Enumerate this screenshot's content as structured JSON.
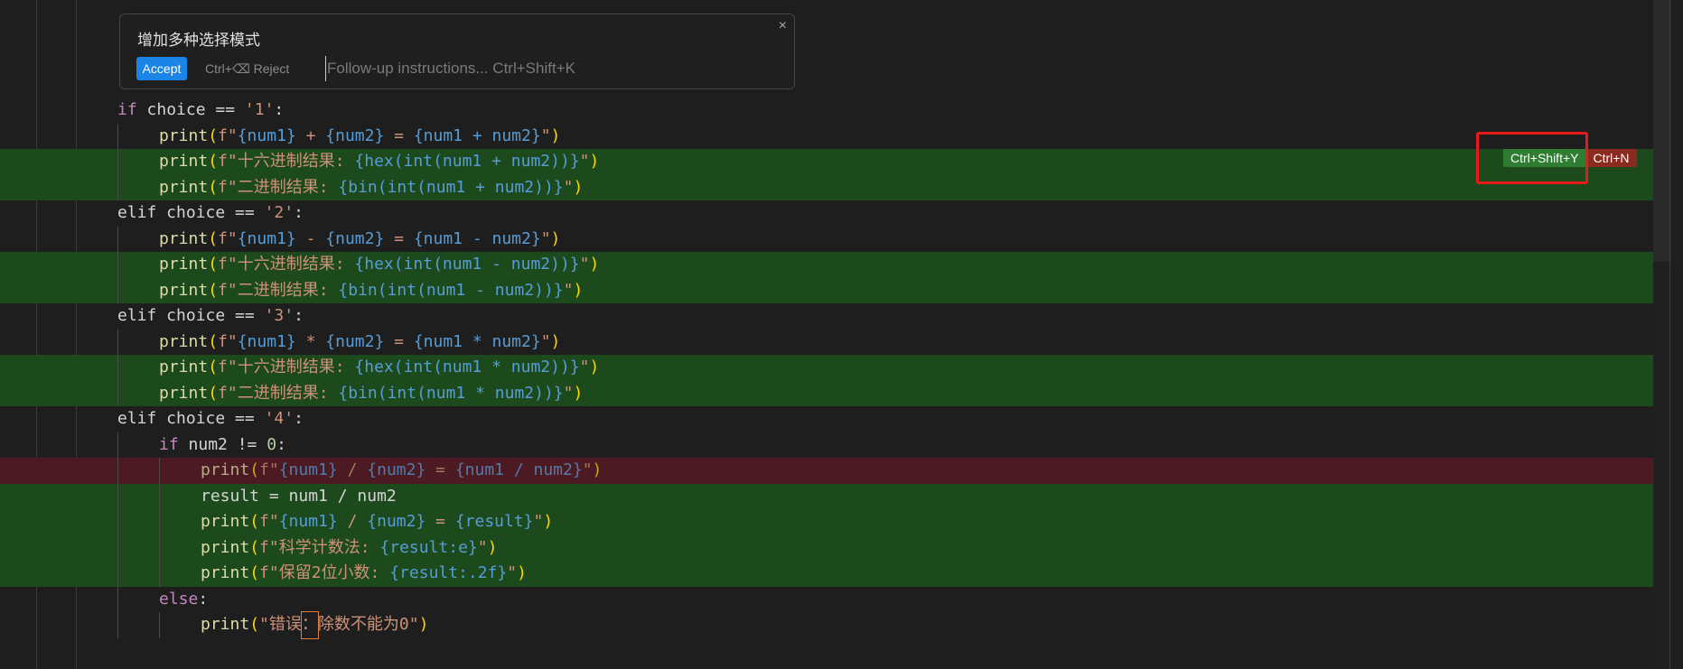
{
  "edit_panel": {
    "title": "增加多种选择模式",
    "close_icon": "×",
    "accept_label": "Accept",
    "reject_label": "Ctrl+⌫ Reject",
    "followup_placeholder": "Follow-up instructions... Ctrl+Shift+K"
  },
  "hunk_actions": {
    "accept_shortcut": "Ctrl+Shift+Y",
    "reject_shortcut": "Ctrl+N"
  },
  "code_lines": [
    {
      "indent": 0,
      "type": "normal",
      "tokens": [
        [
          "kw",
          "if"
        ],
        [
          "var",
          " choice == "
        ],
        [
          "str",
          "'1'"
        ],
        [
          "var",
          ":"
        ]
      ]
    },
    {
      "indent": 1,
      "type": "normal",
      "tokens": [
        [
          "fn",
          "print"
        ],
        [
          "punc",
          "("
        ],
        [
          "str",
          "f\""
        ],
        [
          "brace",
          "{num1}"
        ],
        [
          "str",
          " + "
        ],
        [
          "brace",
          "{num2}"
        ],
        [
          "str",
          " = "
        ],
        [
          "brace",
          "{num1 + num2}"
        ],
        [
          "str",
          "\""
        ],
        [
          "punc",
          ")"
        ]
      ]
    },
    {
      "indent": 1,
      "type": "added",
      "tokens": [
        [
          "fn",
          "print"
        ],
        [
          "punc",
          "("
        ],
        [
          "str",
          "f\"十六进制结果: "
        ],
        [
          "brace",
          "{hex(int(num1 + num2))}"
        ],
        [
          "str",
          "\""
        ],
        [
          "punc",
          ")"
        ]
      ]
    },
    {
      "indent": 1,
      "type": "added",
      "tokens": [
        [
          "fn",
          "print"
        ],
        [
          "punc",
          "("
        ],
        [
          "str",
          "f\"二进制结果: "
        ],
        [
          "brace",
          "{bin(int(num1 + num2))}"
        ],
        [
          "str",
          "\""
        ],
        [
          "punc",
          ")"
        ]
      ]
    },
    {
      "indent": 0,
      "type": "normal",
      "tokens": [
        [
          "var",
          "elif choice == "
        ],
        [
          "str",
          "'2'"
        ],
        [
          "var",
          ":"
        ]
      ]
    },
    {
      "indent": 1,
      "type": "normal",
      "tokens": [
        [
          "fn",
          "print"
        ],
        [
          "punc",
          "("
        ],
        [
          "str",
          "f\""
        ],
        [
          "brace",
          "{num1}"
        ],
        [
          "str",
          " - "
        ],
        [
          "brace",
          "{num2}"
        ],
        [
          "str",
          " = "
        ],
        [
          "brace",
          "{num1 - num2}"
        ],
        [
          "str",
          "\""
        ],
        [
          "punc",
          ")"
        ]
      ]
    },
    {
      "indent": 1,
      "type": "added",
      "tokens": [
        [
          "fn",
          "print"
        ],
        [
          "punc",
          "("
        ],
        [
          "str",
          "f\"十六进制结果: "
        ],
        [
          "brace",
          "{hex(int(num1 - num2))}"
        ],
        [
          "str",
          "\""
        ],
        [
          "punc",
          ")"
        ]
      ]
    },
    {
      "indent": 1,
      "type": "added",
      "tokens": [
        [
          "fn",
          "print"
        ],
        [
          "punc",
          "("
        ],
        [
          "str",
          "f\"二进制结果: "
        ],
        [
          "brace",
          "{bin(int(num1 - num2))}"
        ],
        [
          "str",
          "\""
        ],
        [
          "punc",
          ")"
        ]
      ]
    },
    {
      "indent": 0,
      "type": "normal",
      "tokens": [
        [
          "var",
          "elif choice == "
        ],
        [
          "str",
          "'3'"
        ],
        [
          "var",
          ":"
        ]
      ]
    },
    {
      "indent": 1,
      "type": "normal",
      "tokens": [
        [
          "fn",
          "print"
        ],
        [
          "punc",
          "("
        ],
        [
          "str",
          "f\""
        ],
        [
          "brace",
          "{num1}"
        ],
        [
          "str",
          " * "
        ],
        [
          "brace",
          "{num2}"
        ],
        [
          "str",
          " = "
        ],
        [
          "brace",
          "{num1 * num2}"
        ],
        [
          "str",
          "\""
        ],
        [
          "punc",
          ")"
        ]
      ]
    },
    {
      "indent": 1,
      "type": "added",
      "tokens": [
        [
          "fn",
          "print"
        ],
        [
          "punc",
          "("
        ],
        [
          "str",
          "f\"十六进制结果: "
        ],
        [
          "brace",
          "{hex(int(num1 * num2))}"
        ],
        [
          "str",
          "\""
        ],
        [
          "punc",
          ")"
        ]
      ]
    },
    {
      "indent": 1,
      "type": "added",
      "tokens": [
        [
          "fn",
          "print"
        ],
        [
          "punc",
          "("
        ],
        [
          "str",
          "f\"二进制结果: "
        ],
        [
          "brace",
          "{bin(int(num1 * num2))}"
        ],
        [
          "str",
          "\""
        ],
        [
          "punc",
          ")"
        ]
      ]
    },
    {
      "indent": 0,
      "type": "normal",
      "tokens": [
        [
          "var",
          "elif choice == "
        ],
        [
          "str",
          "'4'"
        ],
        [
          "var",
          ":"
        ]
      ]
    },
    {
      "indent": 1,
      "type": "normal",
      "tokens": [
        [
          "kw",
          "if"
        ],
        [
          "var",
          " num2 != "
        ],
        [
          "num",
          "0"
        ],
        [
          "var",
          ":"
        ]
      ]
    },
    {
      "indent": 2,
      "type": "removed",
      "tokens": [
        [
          "fn",
          "print"
        ],
        [
          "punc",
          "("
        ],
        [
          "str",
          "f\""
        ],
        [
          "brace",
          "{num1}"
        ],
        [
          "str",
          " / "
        ],
        [
          "brace",
          "{num2}"
        ],
        [
          "str",
          " = "
        ],
        [
          "brace",
          "{num1 / num2}"
        ],
        [
          "str",
          "\""
        ],
        [
          "punc",
          ")"
        ]
      ]
    },
    {
      "indent": 2,
      "type": "added",
      "tokens": [
        [
          "var",
          "result = num1 / num2"
        ]
      ]
    },
    {
      "indent": 2,
      "type": "added",
      "tokens": [
        [
          "fn",
          "print"
        ],
        [
          "punc",
          "("
        ],
        [
          "str",
          "f\""
        ],
        [
          "brace",
          "{num1}"
        ],
        [
          "str",
          " / "
        ],
        [
          "brace",
          "{num2}"
        ],
        [
          "str",
          " = "
        ],
        [
          "brace",
          "{result}"
        ],
        [
          "str",
          "\""
        ],
        [
          "punc",
          ")"
        ]
      ]
    },
    {
      "indent": 2,
      "type": "added",
      "tokens": [
        [
          "fn",
          "print"
        ],
        [
          "punc",
          "("
        ],
        [
          "str",
          "f\"科学计数法: "
        ],
        [
          "brace",
          "{result:e}"
        ],
        [
          "str",
          "\""
        ],
        [
          "punc",
          ")"
        ]
      ]
    },
    {
      "indent": 2,
      "type": "added",
      "tokens": [
        [
          "fn",
          "print"
        ],
        [
          "punc",
          "("
        ],
        [
          "str",
          "f\"保留2位小数: "
        ],
        [
          "brace",
          "{result:.2f}"
        ],
        [
          "str",
          "\""
        ],
        [
          "punc",
          ")"
        ]
      ]
    },
    {
      "indent": 1,
      "type": "normal",
      "tokens": [
        [
          "kw",
          "else"
        ],
        [
          "var",
          ":"
        ]
      ]
    },
    {
      "indent": 2,
      "type": "normal",
      "tokens": [
        [
          "fn",
          "print"
        ],
        [
          "punc",
          "("
        ],
        [
          "str",
          "\"错误"
        ],
        [
          "cursor",
          "："
        ],
        [
          "str",
          "除数不能为0\""
        ],
        [
          "punc",
          ")"
        ]
      ]
    }
  ],
  "colors": {
    "added_bg": "#1d4a1d",
    "removed_bg": "#4b1a22",
    "accept_blue": "#1a85e6",
    "highlight_red": "#e81a1a"
  }
}
